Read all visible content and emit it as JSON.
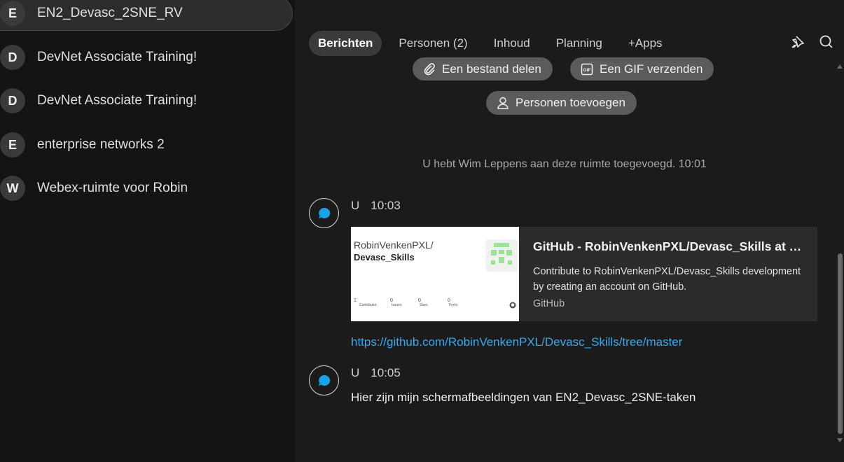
{
  "sidebar": {
    "spaces": [
      {
        "initial": "E",
        "name": "EN2_Devasc_2SNE_RV",
        "active": true
      },
      {
        "initial": "D",
        "name": "DevNet Associate Training!"
      },
      {
        "initial": "D",
        "name": "DevNet Associate Training!"
      },
      {
        "initial": "E",
        "name": "enterprise networks 2"
      },
      {
        "initial": "W",
        "name": "Webex-ruimte voor Robin"
      }
    ]
  },
  "header": {
    "tabs": [
      {
        "label": "Berichten",
        "active": true
      },
      {
        "label": "Personen (2)"
      },
      {
        "label": "Inhoud"
      },
      {
        "label": "Planning"
      },
      {
        "label": "+Apps"
      }
    ],
    "icons": [
      "pin-icon",
      "search-icon"
    ]
  },
  "actions": {
    "share_file": "Een bestand delen",
    "send_gif": "Een GIF verzenden",
    "add_people": "Personen toevoegen"
  },
  "system_message": "U hebt Wim Leppens aan deze ruimte toegevoegd. 10:01",
  "messages": [
    {
      "author": "U",
      "time": "10:03",
      "card": {
        "thumb_owner": "RobinVenkenPXL/",
        "thumb_repo": "Devasc_Skills",
        "thumb_stats": [
          {
            "count": "1",
            "label": "Contributor"
          },
          {
            "count": "0",
            "label": "Issues"
          },
          {
            "count": "0",
            "label": "Stars"
          },
          {
            "count": "0",
            "label": "Forks"
          }
        ],
        "title": "GitHub - RobinVenkenPXL/Devasc_Skills at master",
        "description": "Contribute to RobinVenkenPXL/Devasc_Skills development by creating an account on GitHub.",
        "site": "GitHub"
      },
      "link": "https://github.com/RobinVenkenPXL/Devasc_Skills/tree/master"
    },
    {
      "author": "U",
      "time": "10:05",
      "text": "Hier zijn mijn schermafbeeldingen van EN2_Devasc_2SNE-taken"
    }
  ],
  "colors": {
    "accent_link": "#3aa8ee",
    "avatar_icon": "#1aa3e8"
  }
}
